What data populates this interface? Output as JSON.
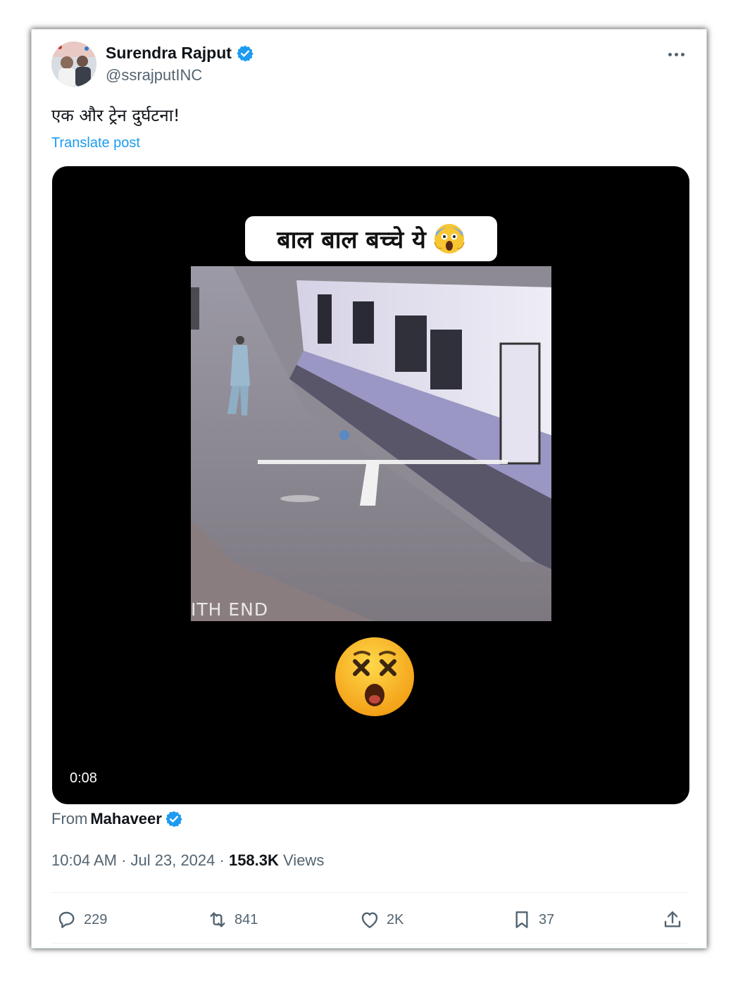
{
  "author": {
    "display_name": "Surendra Rajput",
    "handle": "@ssrajputINC",
    "verified_icon": "verified-badge-icon"
  },
  "post": {
    "text": "एक और ट्रेन दुर्घटना!",
    "translate_label": "Translate post"
  },
  "media": {
    "caption": "बाल बाल बच्चे ये",
    "frame_overlay_text": "ITH END",
    "duration": "0:08"
  },
  "source": {
    "from_label": "From",
    "name": "Mahaveer"
  },
  "meta": {
    "time": "10:04 AM",
    "date": "Jul 23, 2024",
    "separator": " · ",
    "views_count": "158.3K",
    "views_label": "Views"
  },
  "actions": {
    "replies": "229",
    "reposts": "841",
    "likes": "2K",
    "bookmarks": "37"
  },
  "colors": {
    "accent": "#1d9bf0",
    "secondary_text": "#536471",
    "primary_text": "#0f1419"
  }
}
